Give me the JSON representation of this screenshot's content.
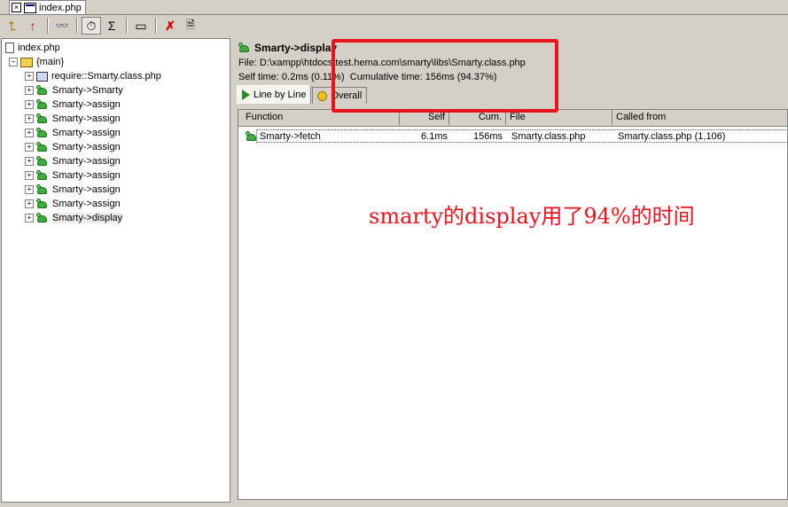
{
  "document_tab": {
    "title": "index.php",
    "close_glyph": "×"
  },
  "toolbar": {
    "buttons": [
      {
        "name": "open-parent-icon",
        "glyph": "⮤"
      },
      {
        "name": "go-up-icon",
        "glyph": "↑"
      },
      {
        "name": "find-icon",
        "glyph": "👓"
      },
      {
        "name": "timer-icon",
        "glyph": "⏱"
      },
      {
        "name": "sum-icon",
        "glyph": "Σ"
      },
      {
        "name": "filter-icon",
        "glyph": "▭"
      },
      {
        "name": "delete-icon",
        "glyph": "✗"
      },
      {
        "name": "export-icon",
        "glyph": "🗎"
      }
    ]
  },
  "tree": {
    "root": "index.php",
    "main": "{main}",
    "children": [
      "require::Smarty.class.php",
      "Smarty->Smarty",
      "Smarty->assign",
      "Smarty->assign",
      "Smarty->assign",
      "Smarty->assign",
      "Smarty->assign",
      "Smarty->assign",
      "Smarty->assign",
      "Smarty->assign",
      "Smarty->display"
    ],
    "expander_plus": "+",
    "expander_minus": "−"
  },
  "details": {
    "function_name": "Smarty->display",
    "file_line": "File: D:\\xampp\\htdocs\\test.hema.com\\smarty\\libs\\Smarty.class.php",
    "self_time": "Self time: 0.2ms (0.11%)",
    "cumulative_time": "Cumulative time: 156ms (94.37%)"
  },
  "view_tabs": [
    {
      "label": "Line by Line",
      "active": true,
      "icon": "play-icon"
    },
    {
      "label": "Overall",
      "active": false,
      "icon": "coin-icon"
    }
  ],
  "grid": {
    "columns": [
      "Function",
      "Self",
      "Cum.",
      "File",
      "Called from"
    ],
    "rows": [
      {
        "function": "Smarty->fetch",
        "self": "6.1ms",
        "cum": "156ms",
        "file": "Smarty.class.php",
        "called_from": "Smarty.class.php (1,106)"
      }
    ]
  },
  "annotation": {
    "text": "smarty的display用了94%的时间",
    "color": "#e8141c"
  },
  "colors": {
    "highlight_red": "#e8141c",
    "window_bg": "#d4d0c8"
  }
}
